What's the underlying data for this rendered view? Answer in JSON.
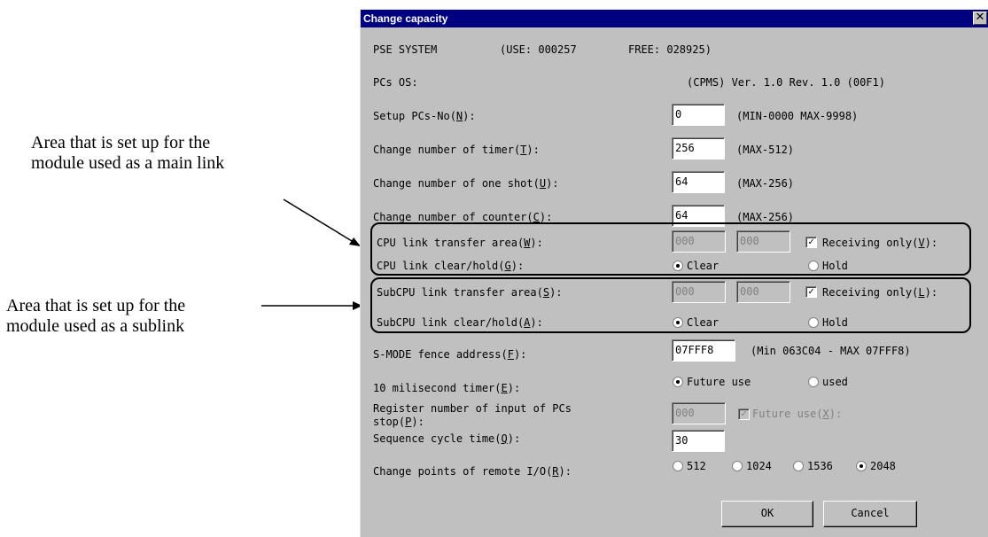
{
  "annotations": {
    "main_link": [
      "Area that is set up for the",
      "module used as a main link"
    ],
    "sublink": [
      "Area that is set up for the",
      "module used as a sublink"
    ]
  },
  "dialog": {
    "title": "Change capacity",
    "close_glyph": "✕",
    "system": {
      "label": "PSE SYSTEM",
      "use": "(USE: 000257",
      "free": "FREE: 028925)"
    },
    "os": {
      "label": "PCs OS:",
      "version": "(CPMS)  Ver. 1.0  Rev. 1.0  (00F1)"
    },
    "setup_no": {
      "label_pre": "Setup PCs-No(",
      "key": "N",
      "label_post": "):",
      "value": "0",
      "hint": "(MIN-0000  MAX-9998)"
    },
    "timer": {
      "label_pre": "Change number of timer(",
      "key": "T",
      "label_post": "):",
      "value": "256",
      "hint": "(MAX-512)"
    },
    "one_shot": {
      "label_pre": "Change number of one shot(",
      "key": "U",
      "label_post": "):",
      "value": "64",
      "hint": "(MAX-256)"
    },
    "counter": {
      "label_pre": "Change number of counter(",
      "key": "C",
      "label_post": "):",
      "value": "64",
      "hint": "(MAX-256)"
    },
    "cpu_link": {
      "area_label_pre": "CPU link transfer area(",
      "area_key": "W",
      "area_label_post": "):",
      "from": "000",
      "to": "000",
      "recv_pre": "Receiving only(",
      "recv_key": "V",
      "recv_post": "):",
      "recv_checked": true,
      "clear_label_pre": "CPU link clear/hold(",
      "clear_key": "G",
      "clear_label_post": "):",
      "opt_clear": "Clear",
      "opt_hold": "Hold",
      "selected": "Clear"
    },
    "subcpu_link": {
      "area_label_pre": "SubCPU link transfer area(",
      "area_key": "S",
      "area_label_post": "):",
      "from": "000",
      "to": "000",
      "recv_pre": "Receiving only(",
      "recv_key": "L",
      "recv_post": "):",
      "recv_checked": true,
      "clear_label_pre": "SubCPU link clear/hold(",
      "clear_key": "A",
      "clear_label_post": "):",
      "opt_clear": "Clear",
      "opt_hold": "Hold",
      "selected": "Clear"
    },
    "fence": {
      "label_pre": "S-MODE fence address(",
      "key": "F",
      "label_post": "):",
      "value": "07FFF8",
      "hint": "(Min 063C04 - MAX 07FFF8)"
    },
    "ms_timer": {
      "label_pre": "10 milisecond timer(",
      "key": "E",
      "label_post": "):",
      "opt_future": "Future use",
      "opt_used": "used",
      "selected": "Future use"
    },
    "register": {
      "label_line1": "Register number of input of PCs",
      "label_pre": "stop(",
      "key": "P",
      "label_post": "):",
      "value": "000",
      "future_pre": "Future use(",
      "future_key": "X",
      "future_post": "):"
    },
    "cycle": {
      "label_pre": "Sequence cycle time(",
      "key": "Q",
      "label_post": "):",
      "value": "30"
    },
    "remote_io": {
      "label_pre": "Change points of remote I/O(",
      "key": "R",
      "label_post": "):",
      "options": [
        "512",
        "1024",
        "1536",
        "2048"
      ],
      "selected": "2048"
    },
    "ok_label": "OK",
    "cancel_label": "Cancel"
  }
}
